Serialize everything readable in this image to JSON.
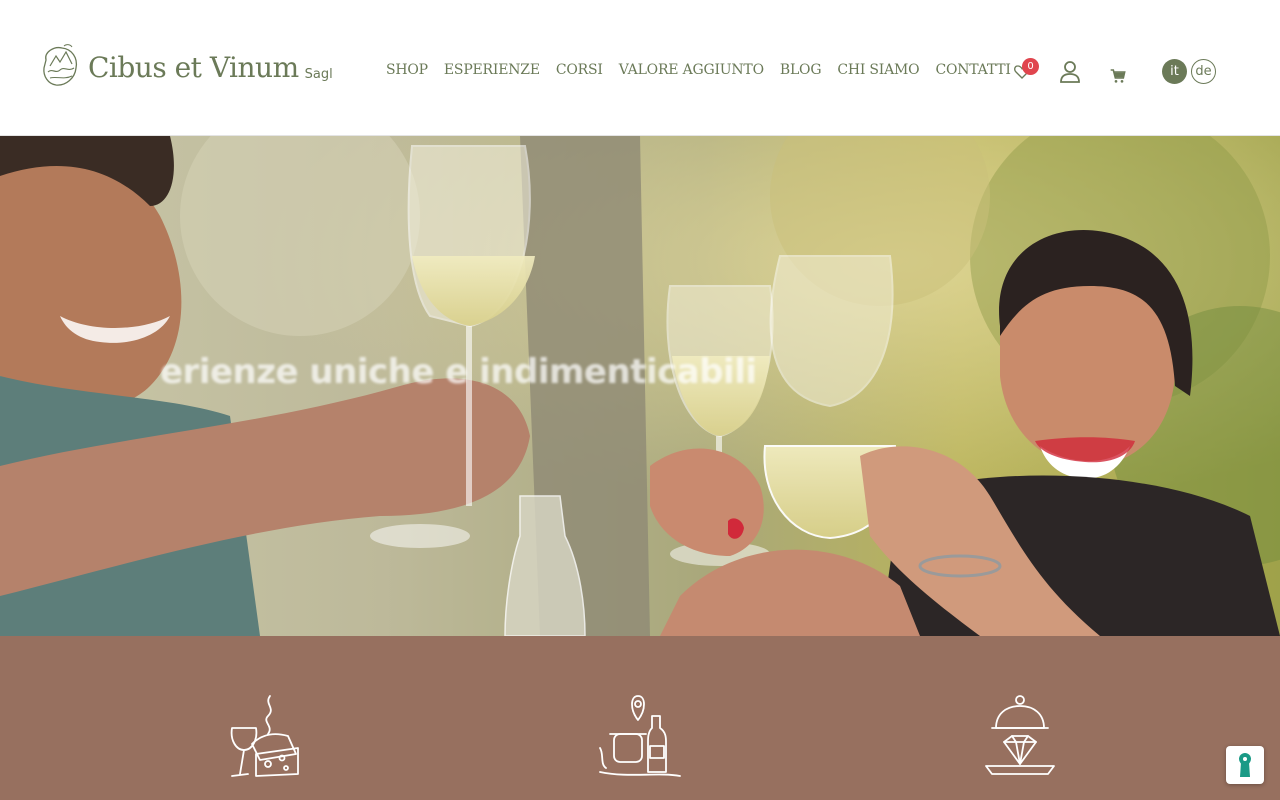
{
  "brand": {
    "name": "Cibus et Vinum",
    "suffix": "Sagl"
  },
  "nav": {
    "items": [
      {
        "label": "SHOP"
      },
      {
        "label": "ESPERIENZE"
      },
      {
        "label": "CORSI"
      },
      {
        "label": "VALORE AGGIUNTO"
      },
      {
        "label": "BLOG"
      },
      {
        "label": "CHI SIAMO"
      },
      {
        "label": "CONTATTI"
      }
    ]
  },
  "header_icons": {
    "wishlist": {
      "icon": "heart-icon",
      "count": "0"
    },
    "account": {
      "icon": "user-icon"
    },
    "cart": {
      "icon": "cart-icon"
    }
  },
  "languages": [
    {
      "code": "it",
      "active": true
    },
    {
      "code": "de",
      "active": false
    }
  ],
  "hero": {
    "caption": "erienze uniche e indimenticabili"
  },
  "features": [
    {
      "icon": "wine-cheese-icon"
    },
    {
      "icon": "local-products-icon"
    },
    {
      "icon": "cloche-diamond-icon"
    }
  ],
  "privacy_button": {
    "icon": "keyhole-icon"
  },
  "colors": {
    "brand_green": "#6b7a58",
    "features_bg": "#97705f",
    "badge_red": "#e0454e"
  }
}
